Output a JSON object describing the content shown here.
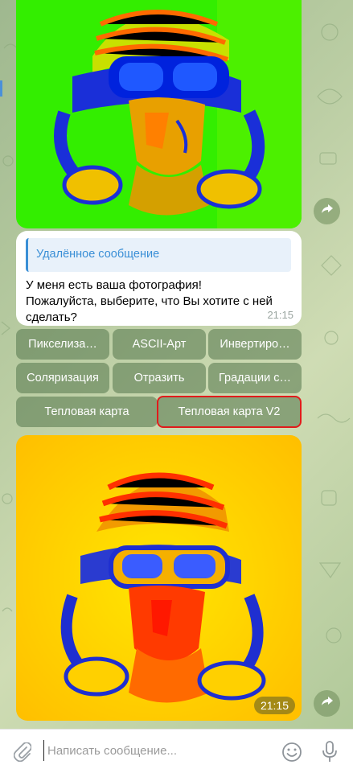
{
  "messages": {
    "top_image": {
      "alt": "Фото",
      "share_icon": "share-arrow-icon"
    },
    "text_message": {
      "reply_quote": "Удалённое сообщение",
      "text": "У меня есть ваша фотография!\nПожалуйста, выберите, что Вы хотите с ней сделать?",
      "time": "21:15"
    },
    "bottom_image": {
      "time": "21:15",
      "share_icon": "share-arrow-icon"
    }
  },
  "keyboard": {
    "row1": [
      "Пикселиза…",
      "ASCII-Арт",
      "Инвертиро…"
    ],
    "row2": [
      "Соляризация",
      "Отразить",
      "Градации с…"
    ],
    "row3": [
      "Тепловая карта",
      "Тепловая карта V2"
    ]
  },
  "composer": {
    "placeholder": "Написать сообщение...",
    "attach_icon": "paperclip-icon",
    "emoji_icon": "emoji-icon",
    "mic_icon": "microphone-icon"
  },
  "colors": {
    "accent": "#3a8fd6",
    "button_bg": "#60805680",
    "highlight_border": "#e11b1b",
    "heatmap_v1_bg": "#33ee00",
    "heatmap_v2_bg": "#ffd000"
  }
}
